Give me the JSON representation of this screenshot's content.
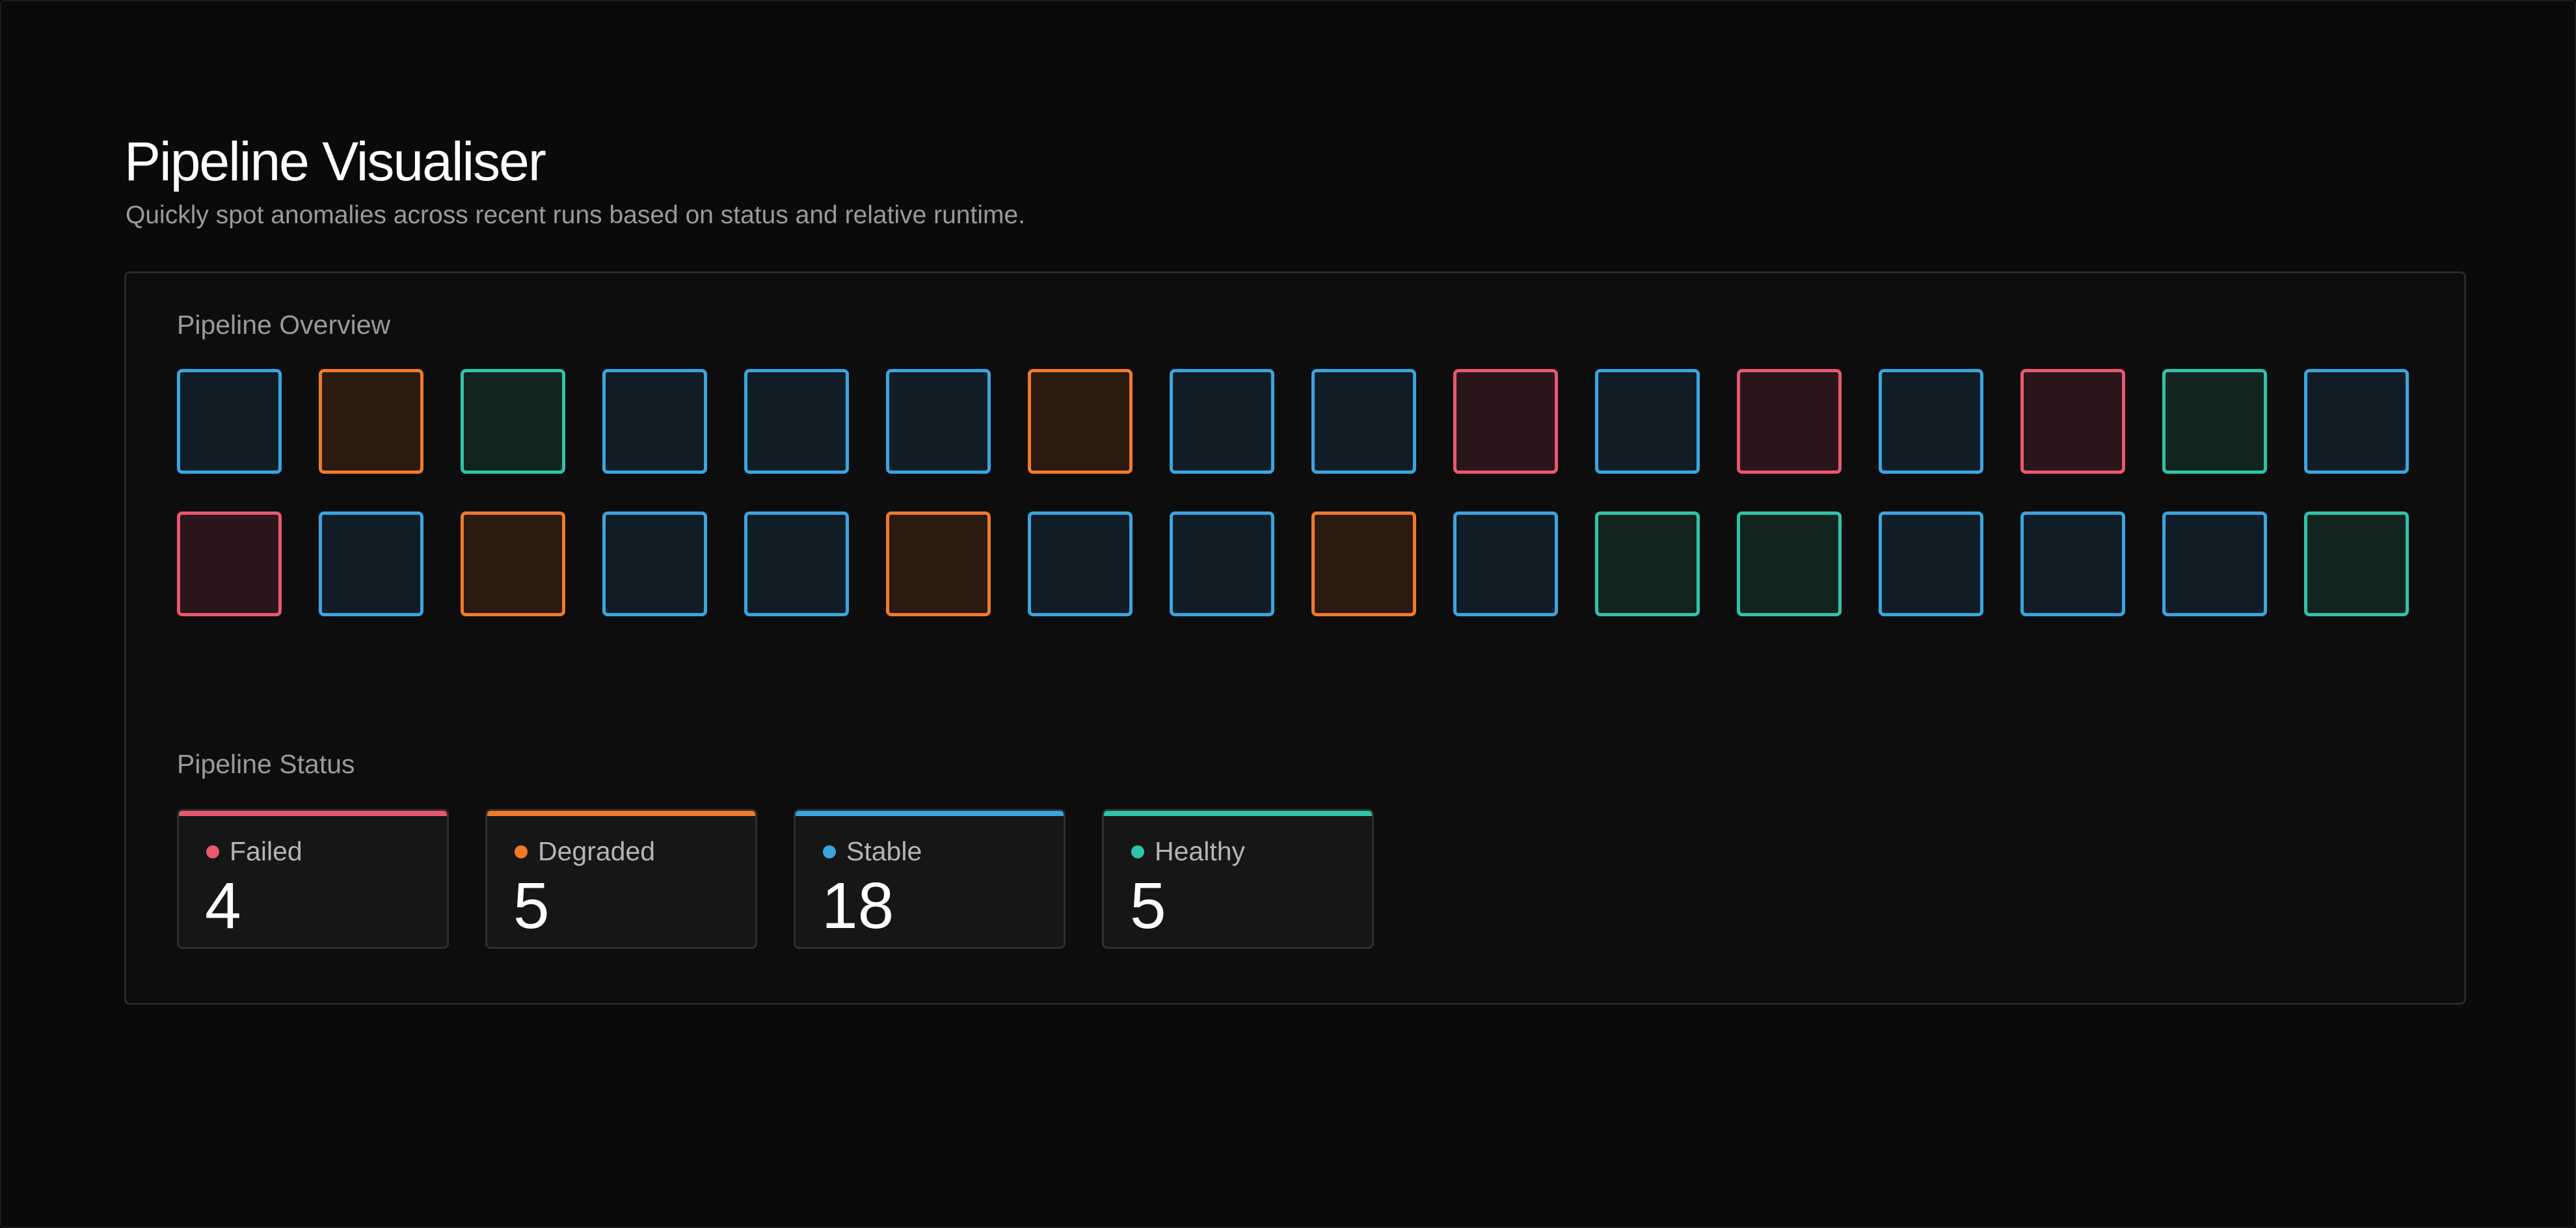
{
  "header": {
    "title": "Pipeline Visualiser",
    "subtitle": "Quickly spot anomalies across recent runs based on status and relative runtime."
  },
  "overview": {
    "title": "Pipeline Overview",
    "runs": [
      "stable",
      "degraded",
      "healthy",
      "stable",
      "stable",
      "stable",
      "degraded",
      "stable",
      "stable",
      "failed",
      "stable",
      "failed",
      "stable",
      "failed",
      "healthy",
      "stable",
      "failed",
      "stable",
      "degraded",
      "stable",
      "stable",
      "degraded",
      "stable",
      "stable",
      "degraded",
      "stable",
      "healthy",
      "healthy",
      "stable",
      "stable",
      "stable",
      "healthy"
    ]
  },
  "status": {
    "title": "Pipeline Status",
    "cards": [
      {
        "key": "failed",
        "label": "Failed",
        "value": "4"
      },
      {
        "key": "degraded",
        "label": "Degraded",
        "value": "5"
      },
      {
        "key": "stable",
        "label": "Stable",
        "value": "18"
      },
      {
        "key": "healthy",
        "label": "Healthy",
        "value": "5"
      }
    ]
  },
  "colors": {
    "failed": "#e9586e",
    "degraded": "#f07a2a",
    "stable": "#3aa5e0",
    "healthy": "#2fc3a9",
    "background": "#0a0a0a",
    "panel": "#0d0d0d"
  }
}
